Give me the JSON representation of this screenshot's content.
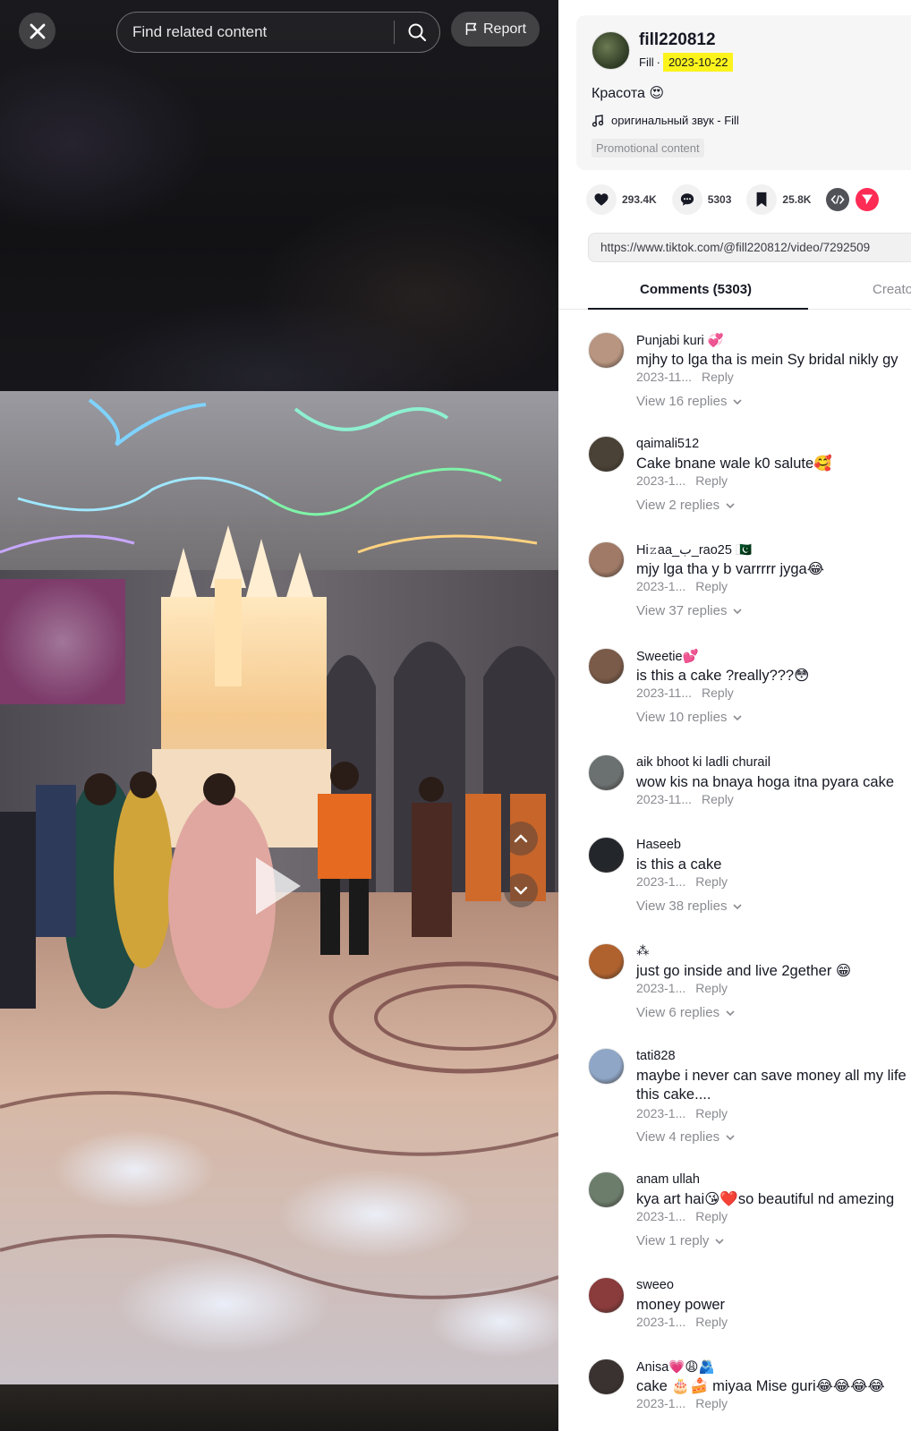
{
  "search": {
    "placeholder": "Find related content"
  },
  "report_label": "Report",
  "author": {
    "name": "fill220812",
    "nickname": "Fill",
    "separator": "·",
    "date": "2023-10-22"
  },
  "caption": "Красота 😍",
  "sound": "оригинальный звук - Fill",
  "promo_label": "Promotional content",
  "stats": {
    "likes": "293.4K",
    "comments": "5303",
    "saves": "25.8K"
  },
  "link_url": "https://www.tiktok.com/@fill220812/video/7292509",
  "tabs": {
    "comments": "Comments (5303)",
    "creator": "Creato"
  },
  "comments": [
    {
      "user": "Punjabi kuri 💞",
      "text": "mjhy to lga tha is mein Sy bridal nikly gy",
      "date": "2023-11...",
      "reply": "Reply",
      "replies": "View 16 replies",
      "avatar_color": "#b89580"
    },
    {
      "user": "qaimali512",
      "text": "Cake bnane wale k0 salute🥰",
      "date": "2023-1...",
      "reply": "Reply",
      "replies": "View 2 replies",
      "avatar_color": "#4a4236"
    },
    {
      "user": "Hi𝚣aa_ب_rao25 🇵🇰",
      "text": "mjy lga tha y b varrrrr jyga😂",
      "date": "2023-1...",
      "reply": "Reply",
      "replies": "View 37 replies",
      "avatar_color": "#a07a66"
    },
    {
      "user": "Sweetie💕",
      "text": "is this a cake ?really???😳",
      "date": "2023-11...",
      "reply": "Reply",
      "replies": "View 10 replies",
      "avatar_color": "#7a5a48"
    },
    {
      "user": "aik bhoot ki ladli churail",
      "text": "wow kis na bnaya hoga itna pyara cake",
      "date": "2023-11...",
      "reply": "Reply",
      "replies": "",
      "avatar_color": "#6b7070"
    },
    {
      "user": "Haseeb",
      "text": "is this a cake",
      "date": "2023-1...",
      "reply": "Reply",
      "replies": "View 38 replies",
      "avatar_color": "#23272c"
    },
    {
      "user": "⁂",
      "text": "just go inside and live 2gether 😁",
      "date": "2023-1...",
      "reply": "Reply",
      "replies": "View 6 replies",
      "avatar_color": "#b0622e"
    },
    {
      "user": "tati828",
      "text": "maybe i never can save money all my life of this cake....",
      "date": "2023-1...",
      "reply": "Reply",
      "replies": "View 4 replies",
      "avatar_color": "#8fa6c6"
    },
    {
      "user": "anam ullah",
      "text": "kya art hai😘❤️so beautiful nd amezing",
      "date": "2023-1...",
      "reply": "Reply",
      "replies": "View 1 reply",
      "avatar_color": "#6c7d6c"
    },
    {
      "user": "sweeo",
      "text": "money power",
      "date": "2023-1...",
      "reply": "Reply",
      "replies": "",
      "avatar_color": "#8a3b3b"
    },
    {
      "user": "Anisa💗😩🫂",
      "text": "cake 🎂🍰 miyaa Mise guri😂😂😂😂",
      "date": "2023-1...",
      "reply": "Reply",
      "replies": "",
      "avatar_color": "#3a3230"
    }
  ],
  "colors": {
    "date_highlight": "#fbf31b",
    "accent_red": "#fe2c55",
    "text_primary": "#161823",
    "text_secondary": "#8a8b91"
  },
  "icons": [
    "close-icon",
    "search-icon",
    "flag-icon",
    "music-note-icon",
    "heart-icon",
    "comment-icon",
    "bookmark-icon",
    "embed-icon",
    "share-icon",
    "chevron-up-icon",
    "chevron-down-icon",
    "play-icon"
  ]
}
